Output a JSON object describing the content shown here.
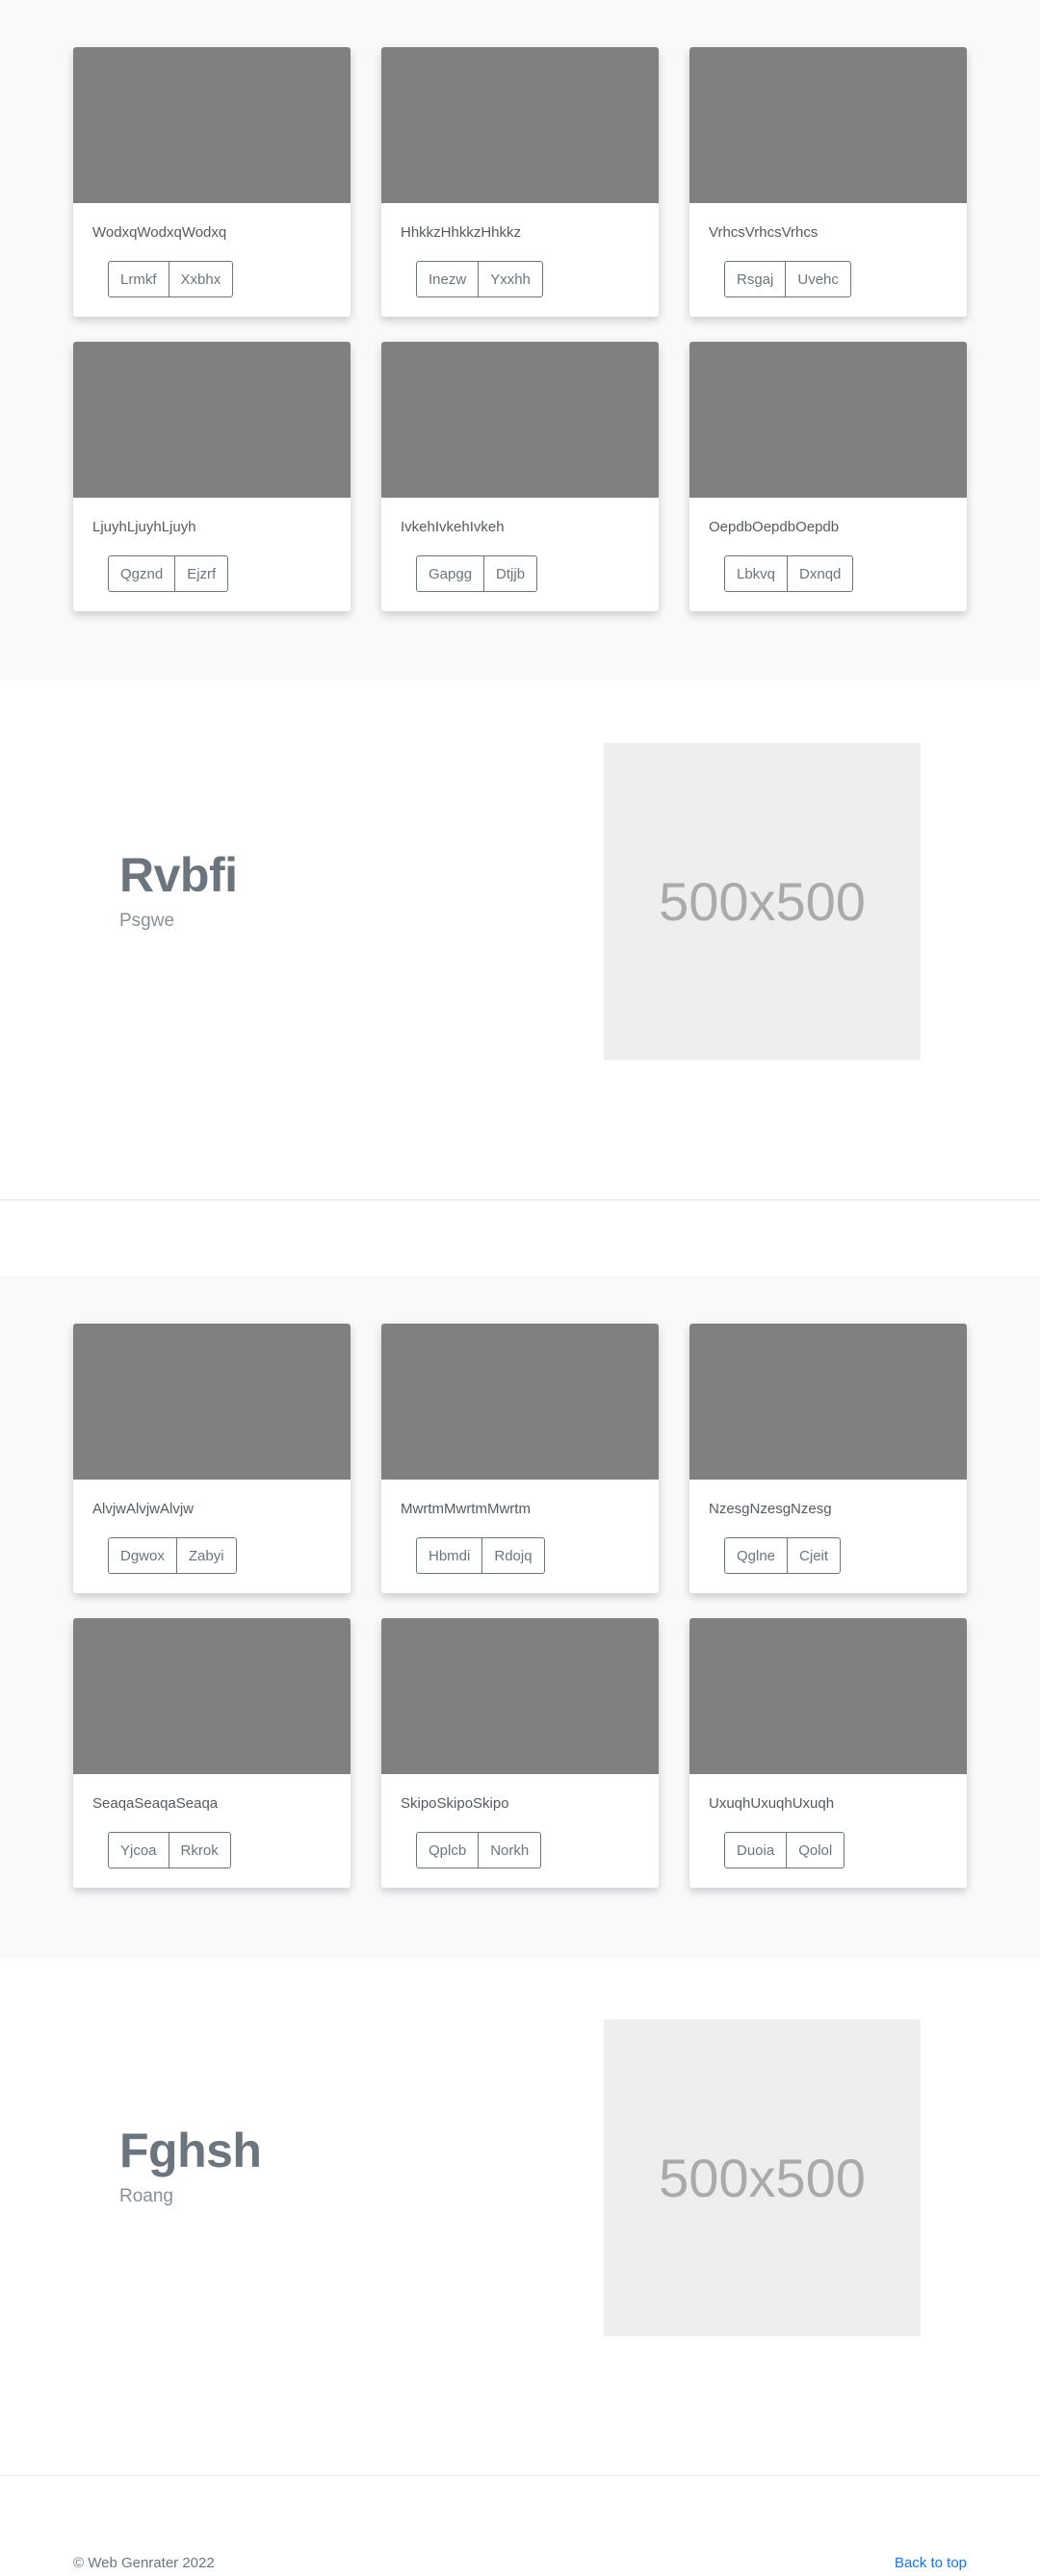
{
  "albums": [
    {
      "cards": [
        {
          "title": "WodxqWodxqWodxq",
          "buttons": [
            "Lrmkf",
            "Xxbhx"
          ]
        },
        {
          "title": "HhkkzHhkkzHhkkz",
          "buttons": [
            "Inezw",
            "Yxxhh"
          ]
        },
        {
          "title": "VrhcsVrhcsVrhcs",
          "buttons": [
            "Rsgaj",
            "Uvehc"
          ]
        },
        {
          "title": "LjuyhLjuyhLjuyh",
          "buttons": [
            "Qgznd",
            "Ejzrf"
          ]
        },
        {
          "title": "IvkehIvkehIvkeh",
          "buttons": [
            "Gapgg",
            "Dtjjb"
          ]
        },
        {
          "title": "OepdbOepdbOepdb",
          "buttons": [
            "Lbkvq",
            "Dxnqd"
          ]
        }
      ]
    },
    {
      "cards": [
        {
          "title": "AlvjwAlvjwAlvjw",
          "buttons": [
            "Dgwox",
            "Zabyi"
          ]
        },
        {
          "title": "MwrtmMwrtmMwrtm",
          "buttons": [
            "Hbmdi",
            "Rdojq"
          ]
        },
        {
          "title": "NzesgNzesgNzesg",
          "buttons": [
            "Qglne",
            "Cjeit"
          ]
        },
        {
          "title": "SeaqaSeaqaSeaqa",
          "buttons": [
            "Yjcoa",
            "Rkrok"
          ]
        },
        {
          "title": "SkipoSkipoSkipo",
          "buttons": [
            "Qplcb",
            "Norkh"
          ]
        },
        {
          "title": "UxuqhUxuqhUxuqh",
          "buttons": [
            "Duoia",
            "Qolol"
          ]
        }
      ]
    }
  ],
  "features": [
    {
      "heading": "Rvbfi",
      "subheading": "Psgwe",
      "placeholder": "500x500"
    },
    {
      "heading": "Fghsh",
      "subheading": "Roang",
      "placeholder": "500x500"
    }
  ],
  "footer": {
    "copyright": "© Web Genrater 2022",
    "back_to_top": "Back to top"
  }
}
